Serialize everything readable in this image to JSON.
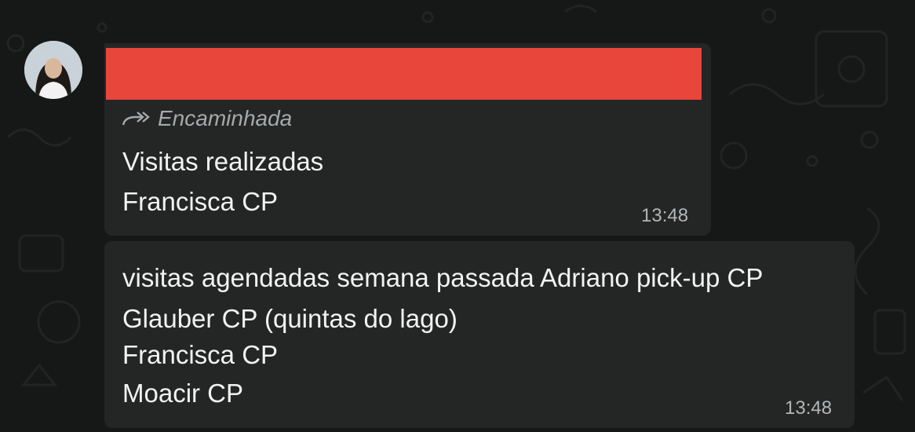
{
  "chat": {
    "messages": [
      {
        "forwarded_label": "Encaminhada",
        "lines": [
          "Visitas realizadas",
          "Francisca CP"
        ],
        "time": "13:48"
      },
      {
        "lines": [
          "visitas agendadas semana passada Adriano pick-up CP",
          "Glauber CP (quintas do lago)",
          "Francisca CP",
          "Moacir CP"
        ],
        "time": "13:48"
      }
    ]
  },
  "colors": {
    "background": "#161717",
    "bubble": "#242626",
    "redaction": "#e8453b",
    "text": "#f2f2f2",
    "meta_text": "#a6a9aa"
  },
  "icons": {
    "forwarded": "forward-arrow-icon",
    "avatar": "user-avatar"
  }
}
